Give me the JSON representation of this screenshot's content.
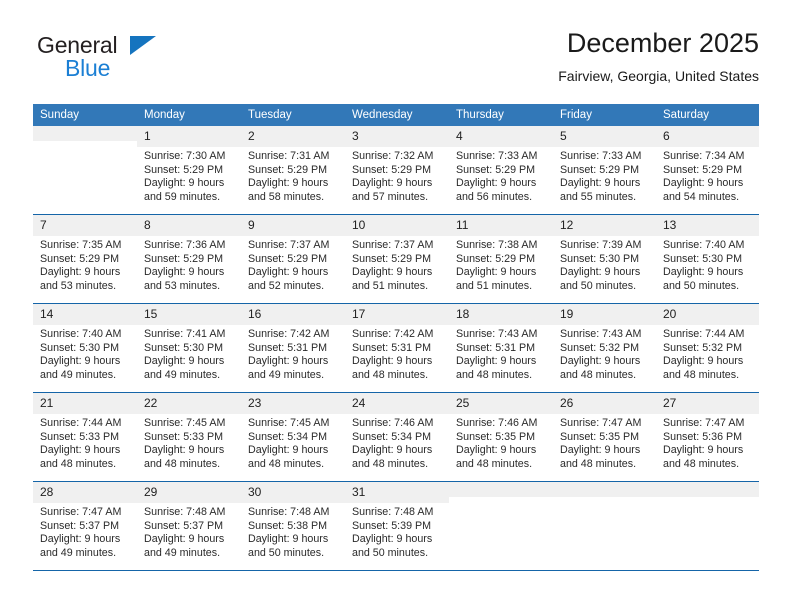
{
  "brand": {
    "name_part1": "General",
    "name_part2": "Blue",
    "triangle_color": "#1574bf",
    "blue_text_color": "#1b7fd4"
  },
  "header": {
    "title": "December 2025",
    "subtitle": "Fairview, Georgia, United States"
  },
  "theme": {
    "header_blue": "#3278b8",
    "rule_blue": "#1565a8",
    "daynum_band": "#f0f0f0"
  },
  "calendar": {
    "weekday_headers": [
      "Sunday",
      "Monday",
      "Tuesday",
      "Wednesday",
      "Thursday",
      "Friday",
      "Saturday"
    ],
    "weeks": [
      [
        {
          "day": "",
          "sunrise": "",
          "sunset": "",
          "daylight1": "",
          "daylight2": ""
        },
        {
          "day": "1",
          "sunrise": "Sunrise: 7:30 AM",
          "sunset": "Sunset: 5:29 PM",
          "daylight1": "Daylight: 9 hours",
          "daylight2": "and 59 minutes."
        },
        {
          "day": "2",
          "sunrise": "Sunrise: 7:31 AM",
          "sunset": "Sunset: 5:29 PM",
          "daylight1": "Daylight: 9 hours",
          "daylight2": "and 58 minutes."
        },
        {
          "day": "3",
          "sunrise": "Sunrise: 7:32 AM",
          "sunset": "Sunset: 5:29 PM",
          "daylight1": "Daylight: 9 hours",
          "daylight2": "and 57 minutes."
        },
        {
          "day": "4",
          "sunrise": "Sunrise: 7:33 AM",
          "sunset": "Sunset: 5:29 PM",
          "daylight1": "Daylight: 9 hours",
          "daylight2": "and 56 minutes."
        },
        {
          "day": "5",
          "sunrise": "Sunrise: 7:33 AM",
          "sunset": "Sunset: 5:29 PM",
          "daylight1": "Daylight: 9 hours",
          "daylight2": "and 55 minutes."
        },
        {
          "day": "6",
          "sunrise": "Sunrise: 7:34 AM",
          "sunset": "Sunset: 5:29 PM",
          "daylight1": "Daylight: 9 hours",
          "daylight2": "and 54 minutes."
        }
      ],
      [
        {
          "day": "7",
          "sunrise": "Sunrise: 7:35 AM",
          "sunset": "Sunset: 5:29 PM",
          "daylight1": "Daylight: 9 hours",
          "daylight2": "and 53 minutes."
        },
        {
          "day": "8",
          "sunrise": "Sunrise: 7:36 AM",
          "sunset": "Sunset: 5:29 PM",
          "daylight1": "Daylight: 9 hours",
          "daylight2": "and 53 minutes."
        },
        {
          "day": "9",
          "sunrise": "Sunrise: 7:37 AM",
          "sunset": "Sunset: 5:29 PM",
          "daylight1": "Daylight: 9 hours",
          "daylight2": "and 52 minutes."
        },
        {
          "day": "10",
          "sunrise": "Sunrise: 7:37 AM",
          "sunset": "Sunset: 5:29 PM",
          "daylight1": "Daylight: 9 hours",
          "daylight2": "and 51 minutes."
        },
        {
          "day": "11",
          "sunrise": "Sunrise: 7:38 AM",
          "sunset": "Sunset: 5:29 PM",
          "daylight1": "Daylight: 9 hours",
          "daylight2": "and 51 minutes."
        },
        {
          "day": "12",
          "sunrise": "Sunrise: 7:39 AM",
          "sunset": "Sunset: 5:30 PM",
          "daylight1": "Daylight: 9 hours",
          "daylight2": "and 50 minutes."
        },
        {
          "day": "13",
          "sunrise": "Sunrise: 7:40 AM",
          "sunset": "Sunset: 5:30 PM",
          "daylight1": "Daylight: 9 hours",
          "daylight2": "and 50 minutes."
        }
      ],
      [
        {
          "day": "14",
          "sunrise": "Sunrise: 7:40 AM",
          "sunset": "Sunset: 5:30 PM",
          "daylight1": "Daylight: 9 hours",
          "daylight2": "and 49 minutes."
        },
        {
          "day": "15",
          "sunrise": "Sunrise: 7:41 AM",
          "sunset": "Sunset: 5:30 PM",
          "daylight1": "Daylight: 9 hours",
          "daylight2": "and 49 minutes."
        },
        {
          "day": "16",
          "sunrise": "Sunrise: 7:42 AM",
          "sunset": "Sunset: 5:31 PM",
          "daylight1": "Daylight: 9 hours",
          "daylight2": "and 49 minutes."
        },
        {
          "day": "17",
          "sunrise": "Sunrise: 7:42 AM",
          "sunset": "Sunset: 5:31 PM",
          "daylight1": "Daylight: 9 hours",
          "daylight2": "and 48 minutes."
        },
        {
          "day": "18",
          "sunrise": "Sunrise: 7:43 AM",
          "sunset": "Sunset: 5:31 PM",
          "daylight1": "Daylight: 9 hours",
          "daylight2": "and 48 minutes."
        },
        {
          "day": "19",
          "sunrise": "Sunrise: 7:43 AM",
          "sunset": "Sunset: 5:32 PM",
          "daylight1": "Daylight: 9 hours",
          "daylight2": "and 48 minutes."
        },
        {
          "day": "20",
          "sunrise": "Sunrise: 7:44 AM",
          "sunset": "Sunset: 5:32 PM",
          "daylight1": "Daylight: 9 hours",
          "daylight2": "and 48 minutes."
        }
      ],
      [
        {
          "day": "21",
          "sunrise": "Sunrise: 7:44 AM",
          "sunset": "Sunset: 5:33 PM",
          "daylight1": "Daylight: 9 hours",
          "daylight2": "and 48 minutes."
        },
        {
          "day": "22",
          "sunrise": "Sunrise: 7:45 AM",
          "sunset": "Sunset: 5:33 PM",
          "daylight1": "Daylight: 9 hours",
          "daylight2": "and 48 minutes."
        },
        {
          "day": "23",
          "sunrise": "Sunrise: 7:45 AM",
          "sunset": "Sunset: 5:34 PM",
          "daylight1": "Daylight: 9 hours",
          "daylight2": "and 48 minutes."
        },
        {
          "day": "24",
          "sunrise": "Sunrise: 7:46 AM",
          "sunset": "Sunset: 5:34 PM",
          "daylight1": "Daylight: 9 hours",
          "daylight2": "and 48 minutes."
        },
        {
          "day": "25",
          "sunrise": "Sunrise: 7:46 AM",
          "sunset": "Sunset: 5:35 PM",
          "daylight1": "Daylight: 9 hours",
          "daylight2": "and 48 minutes."
        },
        {
          "day": "26",
          "sunrise": "Sunrise: 7:47 AM",
          "sunset": "Sunset: 5:35 PM",
          "daylight1": "Daylight: 9 hours",
          "daylight2": "and 48 minutes."
        },
        {
          "day": "27",
          "sunrise": "Sunrise: 7:47 AM",
          "sunset": "Sunset: 5:36 PM",
          "daylight1": "Daylight: 9 hours",
          "daylight2": "and 48 minutes."
        }
      ],
      [
        {
          "day": "28",
          "sunrise": "Sunrise: 7:47 AM",
          "sunset": "Sunset: 5:37 PM",
          "daylight1": "Daylight: 9 hours",
          "daylight2": "and 49 minutes."
        },
        {
          "day": "29",
          "sunrise": "Sunrise: 7:48 AM",
          "sunset": "Sunset: 5:37 PM",
          "daylight1": "Daylight: 9 hours",
          "daylight2": "and 49 minutes."
        },
        {
          "day": "30",
          "sunrise": "Sunrise: 7:48 AM",
          "sunset": "Sunset: 5:38 PM",
          "daylight1": "Daylight: 9 hours",
          "daylight2": "and 50 minutes."
        },
        {
          "day": "31",
          "sunrise": "Sunrise: 7:48 AM",
          "sunset": "Sunset: 5:39 PM",
          "daylight1": "Daylight: 9 hours",
          "daylight2": "and 50 minutes."
        },
        {
          "day": "",
          "sunrise": "",
          "sunset": "",
          "daylight1": "",
          "daylight2": ""
        },
        {
          "day": "",
          "sunrise": "",
          "sunset": "",
          "daylight1": "",
          "daylight2": ""
        },
        {
          "day": "",
          "sunrise": "",
          "sunset": "",
          "daylight1": "",
          "daylight2": ""
        }
      ]
    ]
  }
}
